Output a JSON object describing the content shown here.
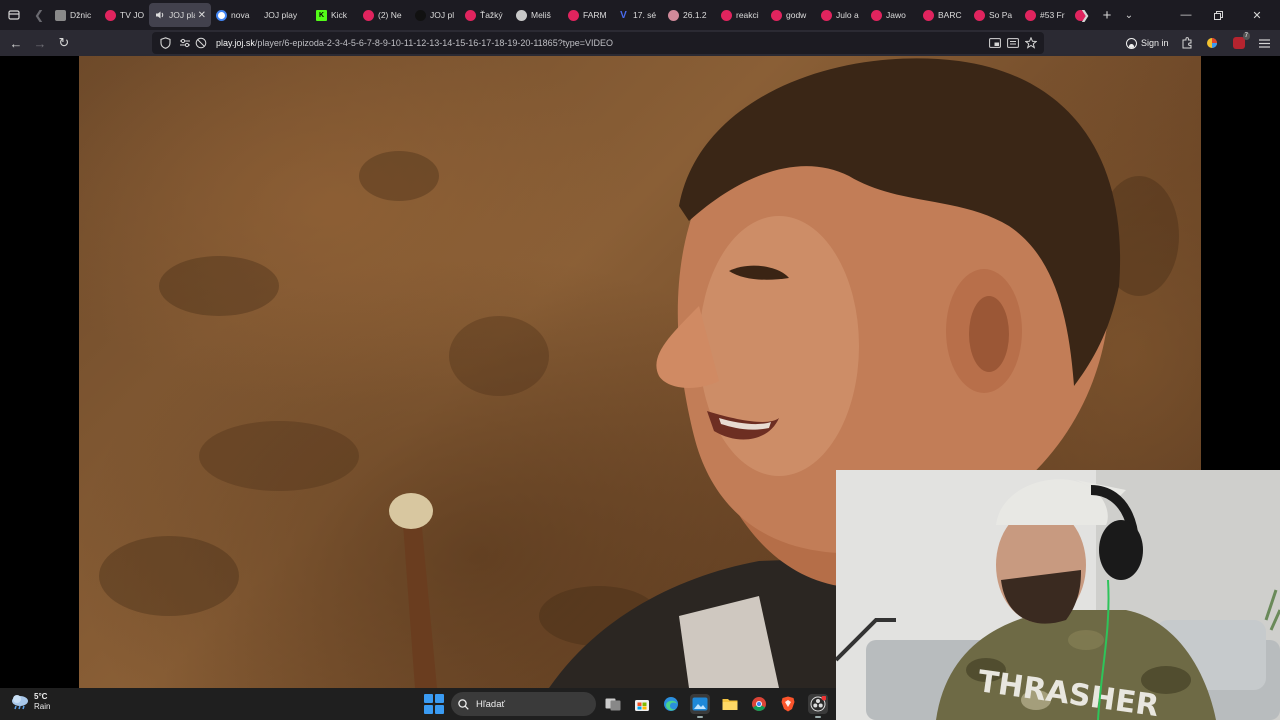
{
  "tabs": [
    {
      "label": "Džnic",
      "favicon": "page-icon",
      "color": "#8a8a8a",
      "active": false
    },
    {
      "label": "TV JOJ",
      "favicon": "joj-icon",
      "color": "#e0245e",
      "active": false
    },
    {
      "label": "JOJ pla",
      "favicon": "speaker-icon",
      "color": "#d0d0d0",
      "active": true
    },
    {
      "label": "nova",
      "favicon": "google-icon",
      "color": "#dddddd",
      "active": false
    },
    {
      "label": "JOJ play",
      "favicon": "",
      "color": "",
      "active": false
    },
    {
      "label": "Kick",
      "favicon": "kick-icon",
      "color": "#53fc18",
      "active": false
    },
    {
      "label": "(2) Ne",
      "favicon": "youtube-icon",
      "color": "#e0245e",
      "active": false
    },
    {
      "label": "JOJ pl",
      "favicon": "tiktok-icon",
      "color": "#111111",
      "active": false
    },
    {
      "label": "Ťažký",
      "favicon": "bookmark-icon",
      "color": "#e0245e",
      "active": false
    },
    {
      "label": "Meliš",
      "favicon": "tomato-icon",
      "color": "#c8c8c8",
      "active": false
    },
    {
      "label": "FARM",
      "favicon": "youtube-icon",
      "color": "#e0245e",
      "active": false
    },
    {
      "label": "17. sé",
      "favicon": "v-icon",
      "color": "#4a6cf0",
      "active": false
    },
    {
      "label": "26.1.2",
      "favicon": "avatar-icon",
      "color": "#d08a9a",
      "active": false
    },
    {
      "label": "reakci",
      "favicon": "youtube-icon",
      "color": "#e0245e",
      "active": false
    },
    {
      "label": "godw",
      "favicon": "youtube-icon",
      "color": "#e0245e",
      "active": false
    },
    {
      "label": "Julo a",
      "favicon": "youtube-icon",
      "color": "#e0245e",
      "active": false
    },
    {
      "label": "Jawo",
      "favicon": "youtube-icon",
      "color": "#e0245e",
      "active": false
    },
    {
      "label": "BARC",
      "favicon": "youtube-icon",
      "color": "#e0245e",
      "active": false
    },
    {
      "label": "So Pa",
      "favicon": "youtube-icon",
      "color": "#e0245e",
      "active": false
    },
    {
      "label": "#53 Fr",
      "favicon": "youtube-icon",
      "color": "#e0245e",
      "active": false
    },
    {
      "label": "",
      "favicon": "youtube-icon",
      "color": "#e0245e",
      "active": false
    }
  ],
  "nav": {
    "url_domain": "play.joj.sk",
    "url_rest": "/player/6-epizoda-2-3-4-5-6-7-8-9-10-11-12-13-14-15-16-17-18-19-20-11865?type=VIDEO",
    "sign_in": "Sign in",
    "extension_badge": "7"
  },
  "taskbar": {
    "weather_temp": "5°C",
    "weather_desc": "Rain",
    "search_placeholder": "Hľadať"
  },
  "colors": {
    "tabbar_bg": "#1c1b22",
    "navbar_bg": "#2b2a33",
    "active_tab": "#42414d",
    "taskbar_bg": "#1f1f1f",
    "accent_red": "#e0245e"
  }
}
